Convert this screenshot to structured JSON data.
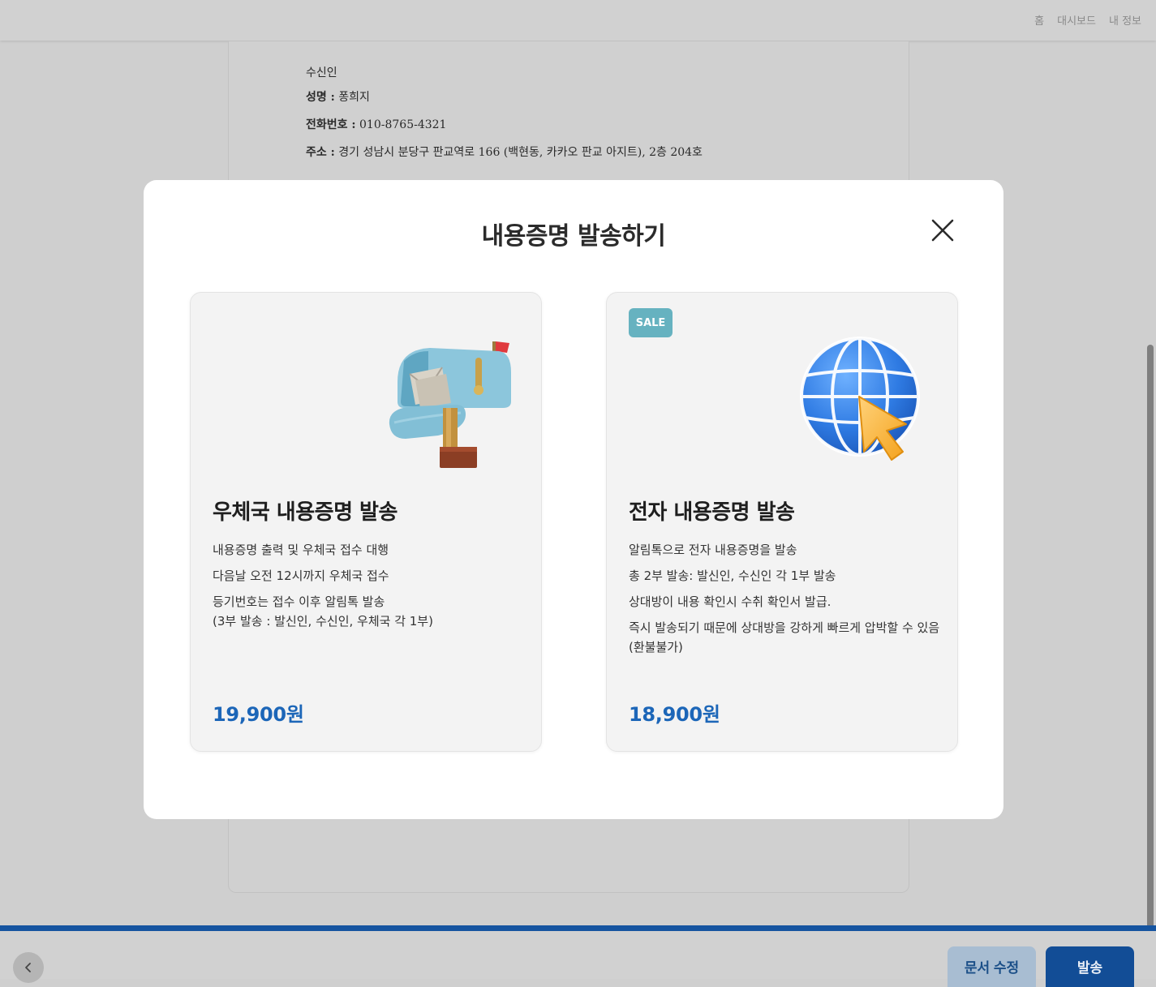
{
  "topnav": {
    "items": [
      "홈",
      "대시보드",
      "내 정보"
    ]
  },
  "document": {
    "recipient_heading": "수신인",
    "name_label": "성명 :",
    "name_value": "퐁희지",
    "phone_label": "전화번호 :",
    "phone_value": "010-8765-4321",
    "address_label": "주소 :",
    "address_value": "경기 성남시 분당구 판교역로 166 (백현동, 카카오 판교 아지트), 2층 204호"
  },
  "modal": {
    "title": "내용증명 발송하기",
    "close_icon": "close-icon",
    "cards": [
      {
        "title": "우체국 내용증명 발송",
        "icon": "mailbox-icon",
        "lines": [
          "내용증명 출력 및 우체국 접수 대행",
          "다음날 오전 12시까지 우체국 접수",
          "등기번호는 접수 이후 알림톡 발송\n(3부 발송 : 발신인, 수신인, 우체국 각 1부)"
        ],
        "price": "19,900원"
      },
      {
        "badge": "SALE",
        "title": "전자 내용증명 발송",
        "icon": "globe-cursor-icon",
        "lines": [
          "알림톡으로 전자 내용증명을 발송",
          "총 2부 발송: 발신인, 수신인 각 1부 발송",
          "상대방이 내용 확인시 수취 확인서 발급.",
          "즉시 발송되기 때문에 상대방을 강하게 빠르게 압박할 수 있음\n(환불불가)"
        ],
        "price": "18,900원"
      }
    ]
  },
  "footer": {
    "back_icon": "chevron-left-icon",
    "edit_label": "문서 수정",
    "send_label": "발송"
  },
  "colors": {
    "accent": "#1c66b8",
    "primary_button": "#124d96",
    "sale_badge": "#66b2c0",
    "overlay": "#cfcfcf"
  }
}
